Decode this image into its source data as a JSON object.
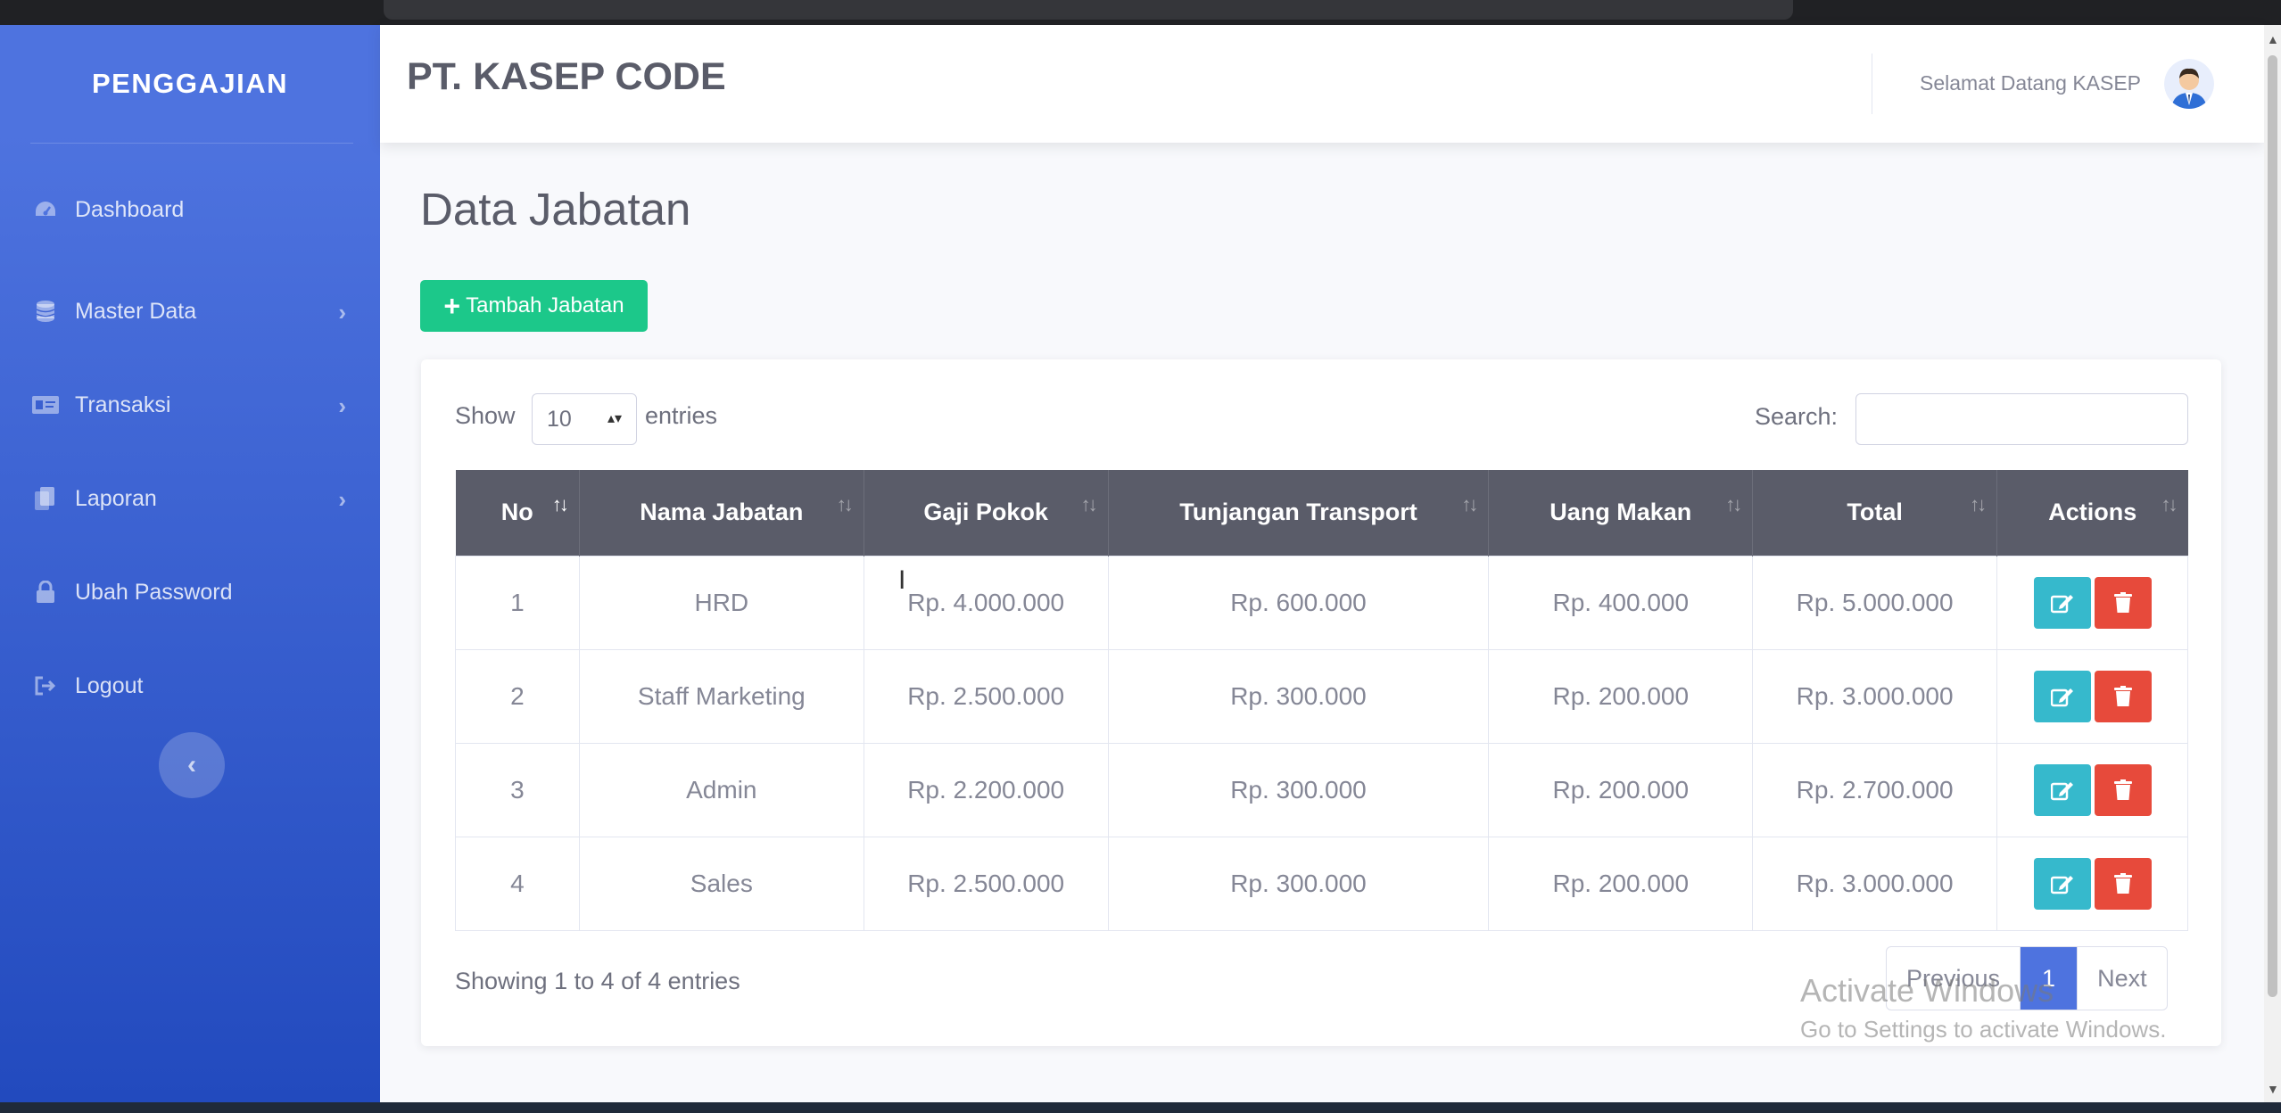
{
  "sidebar": {
    "brand": "PENGGAJIAN",
    "items": [
      {
        "label": "Dashboard",
        "icon": "tachometer-icon"
      },
      {
        "label": "Master Data",
        "icon": "database-icon"
      },
      {
        "label": "Transaksi",
        "icon": "id-card-icon"
      },
      {
        "label": "Laporan",
        "icon": "copy-icon"
      },
      {
        "label": "Ubah Password",
        "icon": "lock-icon"
      },
      {
        "label": "Logout",
        "icon": "sign-out-icon"
      }
    ]
  },
  "header": {
    "company": "PT. KASEP CODE",
    "welcome": "Selamat Datang KASEP"
  },
  "page": {
    "title": "Data Jabatan",
    "add_button": "Tambah Jabatan"
  },
  "table_controls": {
    "show_label": "Show",
    "entries_value": "10",
    "entries_label": "entries",
    "search_label": "Search:"
  },
  "table": {
    "columns": [
      "No",
      "Nama Jabatan",
      "Gaji Pokok",
      "Tunjangan Transport",
      "Uang Makan",
      "Total",
      "Actions"
    ],
    "rows": [
      [
        "1",
        "HRD",
        "Rp. 4.000.000",
        "Rp. 600.000",
        "Rp. 400.000",
        "Rp. 5.000.000"
      ],
      [
        "2",
        "Staff Marketing",
        "Rp. 2.500.000",
        "Rp. 300.000",
        "Rp. 200.000",
        "Rp. 3.000.000"
      ],
      [
        "3",
        "Admin",
        "Rp. 2.200.000",
        "Rp. 300.000",
        "Rp. 200.000",
        "Rp. 2.700.000"
      ],
      [
        "4",
        "Sales",
        "Rp. 2.500.000",
        "Rp. 300.000",
        "Rp. 200.000",
        "Rp. 3.000.000"
      ]
    ]
  },
  "footer": {
    "info": "Showing 1 to 4 of 4 entries",
    "previous": "Previous",
    "current_page": "1",
    "next": "Next"
  },
  "watermark": {
    "line1": "Activate Windows",
    "line2": "Go to Settings to activate Windows."
  },
  "colors": {
    "sidebar_top": "#4e73df",
    "sidebar_bottom": "#224abe",
    "success": "#1cc88a",
    "info": "#36b9cc",
    "danger": "#e74a3b",
    "table_header": "#5a5c69"
  }
}
